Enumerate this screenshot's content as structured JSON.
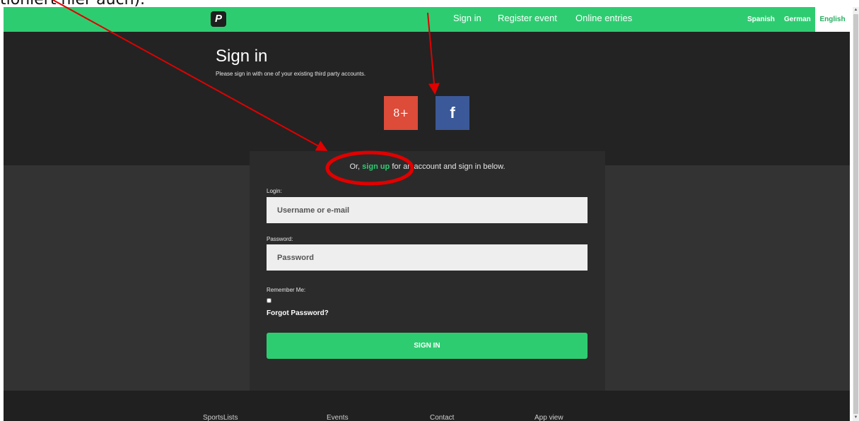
{
  "caption": {
    "text": "tioniert hier auch)."
  },
  "navbar": {
    "logo_letter": "P",
    "links": [
      "Sign in",
      "Register event",
      "Online entries"
    ],
    "languages": [
      "Spanish",
      "German",
      "English"
    ],
    "active_language": "English"
  },
  "hero": {
    "title": "Sign in",
    "subtitle": "Please sign in with one of your existing third party accounts.",
    "social": {
      "google_label": "8+",
      "facebook_label": "f"
    }
  },
  "form": {
    "signup_prefix": "Or, ",
    "signup_link": "sign up",
    "signup_suffix": " for an account and sign in below.",
    "login_label": "Login:",
    "login_placeholder": "Username or e-mail",
    "password_label": "Password:",
    "password_placeholder": "Password",
    "remember_label": "Remember Me:",
    "remember_checked": false,
    "forgot_label": "Forgot Password?",
    "submit_label": "SIGN IN"
  },
  "footer": {
    "links": [
      "SportsLists",
      "Events",
      "Contact",
      "App view"
    ]
  },
  "colors": {
    "brand_green": "#2ecc71",
    "dark_bg": "#232323",
    "google_red": "#dd4b39",
    "facebook_blue": "#3b5998",
    "annotation_red": "#e00000"
  }
}
